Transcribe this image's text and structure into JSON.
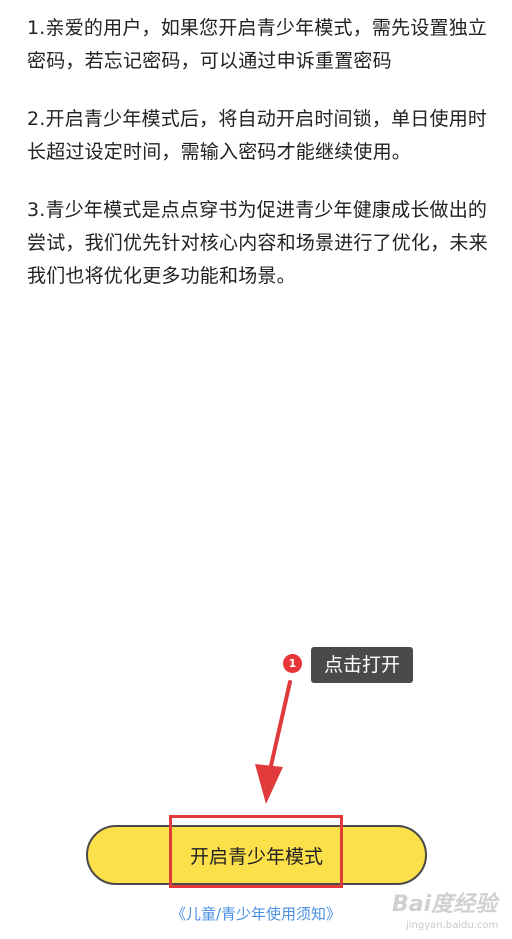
{
  "paragraphs": [
    "1.亲爱的用户，如果您开启青少年模式，需先设置独立密码，若忘记密码，可以通过申诉重置密码",
    "2.开启青少年模式后，将自动开启时间锁，单日使用时长超过设定时间，需输入密码才能继续使用。",
    "3.青少年模式是点点穿书为促进青少年健康成长做出的尝试，我们优先针对核心内容和场景进行了优化，未来我们也将优化更多功能和场景。"
  ],
  "annotation": {
    "step_number": "1",
    "tooltip_text": "点击打开"
  },
  "button": {
    "label": "开启青少年模式"
  },
  "notice_link": "《儿童/青少年使用须知》",
  "watermark": {
    "logo_text": "Bai度经验",
    "url": "jingyan.baidu.com"
  },
  "colors": {
    "button_fill": "#fbe04a",
    "highlight": "#e03a3a",
    "link": "#4a90e2",
    "tooltip_bg": "#4a4a4a"
  }
}
